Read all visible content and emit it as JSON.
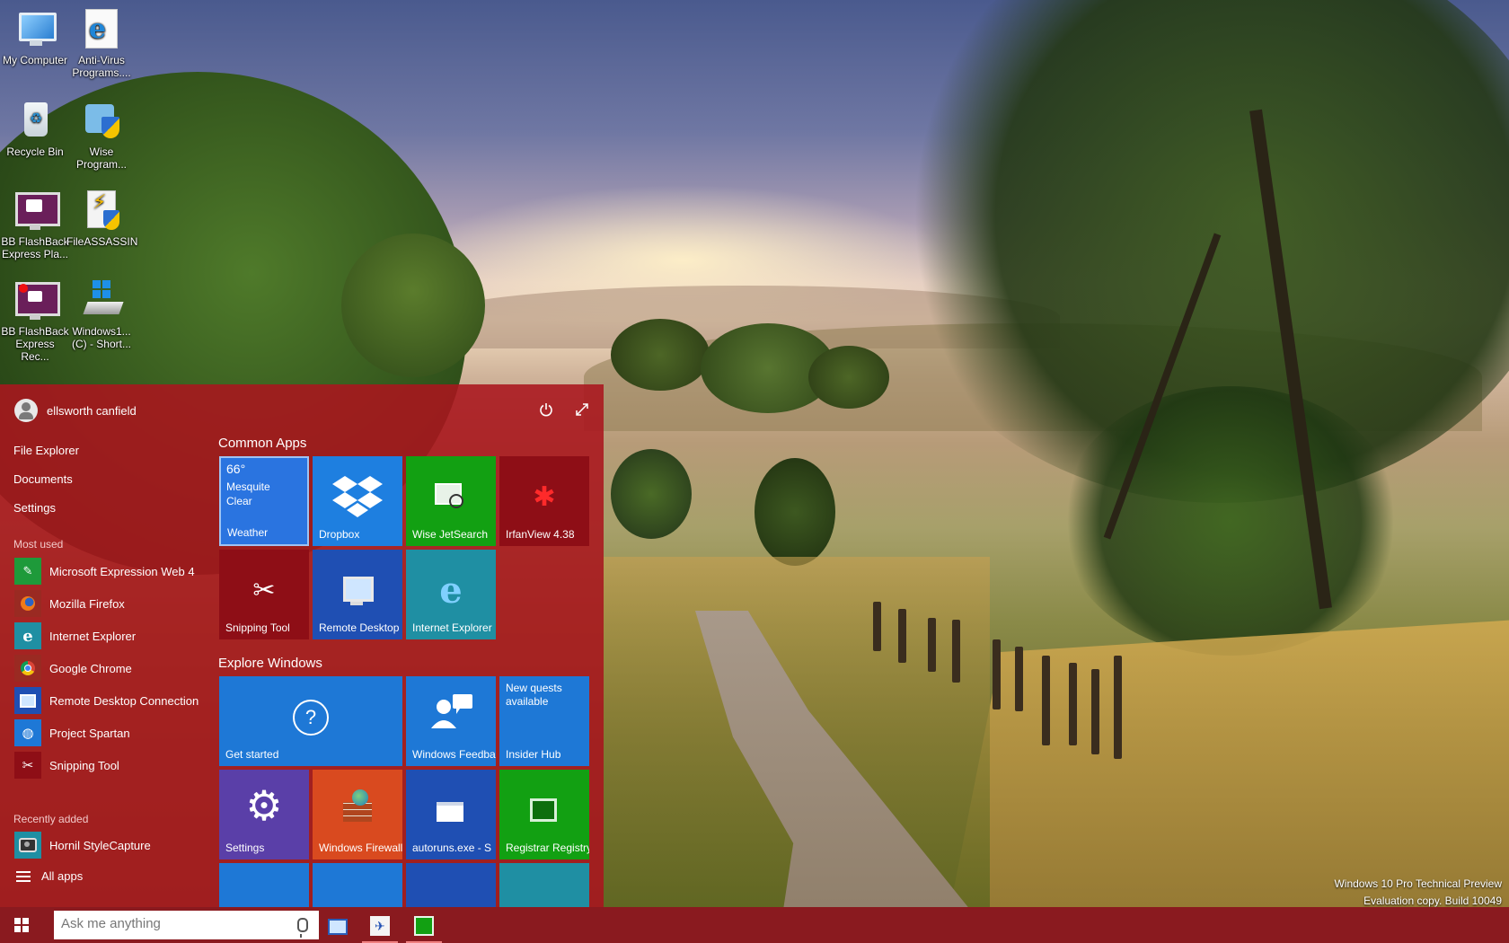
{
  "colors": {
    "accent": "#aa161e",
    "taskbar": "#8a1a1f",
    "tile_blue": "#1e78d6",
    "tile_green": "#12a012",
    "tile_darkred": "#8e0e16",
    "tile_teal": "#1f8fa3",
    "tile_purple": "#5a3fa8",
    "tile_orange": "#d94a1f",
    "tile_navy": "#1f4fb3"
  },
  "desktop": {
    "icons": [
      {
        "label": "My Computer",
        "icon": "monitor-icon"
      },
      {
        "label": "Anti-Virus Programs....",
        "icon": "internet-explorer-icon"
      },
      {
        "label": "Recycle Bin",
        "icon": "recycle-bin-icon"
      },
      {
        "label": "Wise Program...",
        "icon": "installer-shield-icon"
      },
      {
        "label": "BB FlashBack Express Pla...",
        "icon": "video-player-icon"
      },
      {
        "label": "FileASSASSIN",
        "icon": "file-shield-icon"
      },
      {
        "label": "BB FlashBack Express Rec...",
        "icon": "video-recorder-icon"
      },
      {
        "label": "Windows1... (C) - Short...",
        "icon": "drive-shortcut-icon"
      }
    ]
  },
  "start": {
    "user": {
      "name": "ellsworth canfield"
    },
    "places": [
      "File Explorer",
      "Documents",
      "Settings"
    ],
    "most_used_title": "Most used",
    "most_used": [
      {
        "label": "Microsoft Expression Web 4",
        "icon": "expression-web-icon",
        "color": "#1e9a3a"
      },
      {
        "label": "Mozilla Firefox",
        "icon": "firefox-icon",
        "color": "#9a2a22"
      },
      {
        "label": "Internet Explorer",
        "icon": "internet-explorer-icon",
        "color": "#1f8fa3"
      },
      {
        "label": "Google Chrome",
        "icon": "chrome-icon",
        "color": "#9a2a22"
      },
      {
        "label": "Remote Desktop Connection",
        "icon": "remote-desktop-icon",
        "color": "#1f4fb3"
      },
      {
        "label": "Project Spartan",
        "icon": "globe-icon",
        "color": "#1e78d6"
      },
      {
        "label": "Snipping Tool",
        "icon": "scissors-icon",
        "color": "#8e0e16"
      }
    ],
    "recently_added_title": "Recently added",
    "recently_added": [
      {
        "label": "Hornil StyleCapture",
        "icon": "camera-icon",
        "color": "#1f8fa3"
      }
    ],
    "all_apps": "All apps",
    "groups": [
      {
        "title": "Common Apps"
      },
      {
        "title": "Explore Windows"
      }
    ],
    "tiles_common": [
      {
        "label": "Weather",
        "lines": [
          "66°",
          "Mesquite",
          "Clear"
        ]
      },
      {
        "label": "Dropbox"
      },
      {
        "label": "Wise JetSearch"
      },
      {
        "label": "IrfanView 4.38"
      },
      {
        "label": "Snipping Tool"
      },
      {
        "label": "Remote Desktop"
      },
      {
        "label": "Internet Explorer"
      }
    ],
    "tiles_explore": [
      {
        "label": "Get started",
        "glyph": "?"
      },
      {
        "label": "Windows Feedback"
      },
      {
        "label": "Insider Hub",
        "lines": [
          "New quests",
          "available"
        ]
      },
      {
        "label": "Settings"
      },
      {
        "label": "Windows Firewall"
      },
      {
        "label": "autoruns.exe - S"
      },
      {
        "label": "Registrar Registry"
      }
    ]
  },
  "taskbar": {
    "search_placeholder": "Ask me anything",
    "pinned": [
      "remote-desktop-icon",
      "snipping-app-icon",
      "registry-app-icon"
    ]
  },
  "watermark": {
    "line1": "Windows 10 Pro Technical Preview",
    "line2": "Evaluation copy. Build 10049"
  }
}
